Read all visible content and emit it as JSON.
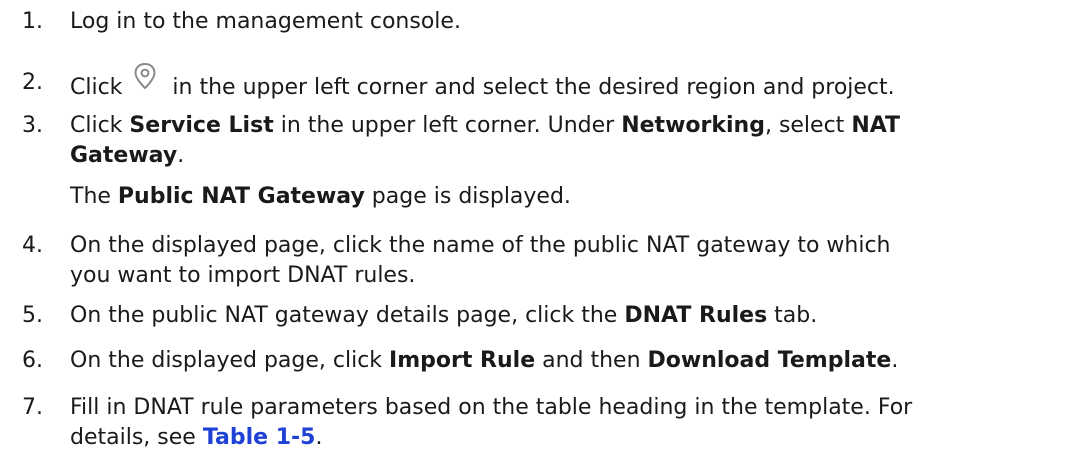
{
  "steps": [
    {
      "num": "1.",
      "text": "Log in to the management console."
    },
    {
      "num": "2.",
      "before": "Click",
      "icon": "location-pin-icon",
      "after": "in the upper left corner and select the desired region and project."
    },
    {
      "num": "3.",
      "t1": "Click ",
      "b1": "Service List",
      "t2": " in the upper left corner. Under ",
      "b2": "Networking",
      "t3": ", select ",
      "b3": "NAT",
      "b4": "Gateway",
      "t4": "."
    },
    {
      "note_b": "Public NAT Gateway",
      "note_t1": "The ",
      "note_t2": " page is displayed."
    },
    {
      "num": "4.",
      "line1": "On the displayed page, click the name of the public NAT gateway to which",
      "line2": "you want to import DNAT rules."
    },
    {
      "num": "5.",
      "t1": "On the public NAT gateway details page, click the ",
      "b1": "DNAT Rules",
      "t2": " tab."
    },
    {
      "num": "6.",
      "t1": "On the displayed page, click ",
      "b1": "Import Rule",
      "t2": " and then ",
      "b2": "Download Template",
      "t3": "."
    },
    {
      "num": "7.",
      "line1": "Fill in DNAT rule parameters based on the table heading in the template. For",
      "t1": "details, see ",
      "link": "Table 1-5",
      "t2": "."
    }
  ]
}
